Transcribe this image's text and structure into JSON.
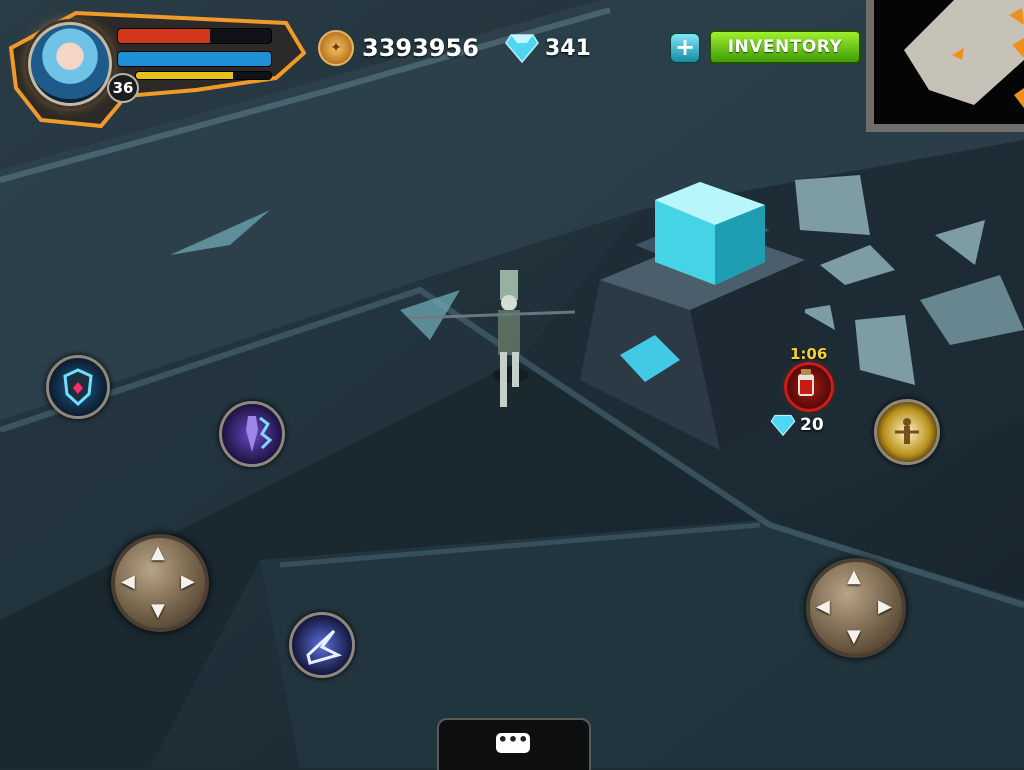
{
  "player": {
    "level": "36",
    "health_fraction": 0.6,
    "mana_fraction": 1.0,
    "xp_fraction": 0.72,
    "colors": {
      "health": "#d2361b",
      "mana": "#1f8fd6",
      "xp": "#e7c21a"
    }
  },
  "currency": {
    "gold": "3393956",
    "gems": "341",
    "gold_icon": "gold-coin-icon",
    "gem_icon": "diamond-icon"
  },
  "buttons": {
    "inventory_label": "INVENTORY",
    "add_gems_icon": "plus-icon"
  },
  "buff": {
    "timer": "1:06",
    "reward_gems": "20",
    "potion_icon": "health-potion-icon"
  },
  "skills": [
    {
      "name": "shield-skill",
      "icon": "shield-icon"
    },
    {
      "name": "summon-skill",
      "icon": "figure-icon"
    },
    {
      "name": "lightning-skill",
      "icon": "lightning-icon"
    },
    {
      "name": "aura-skill",
      "icon": "aura-icon"
    }
  ],
  "controls": {
    "left_dpad_icon": "move-arrows-icon",
    "right_dpad_icon": "move-arrows-icon",
    "chat_icon": "speech-bubble-icon"
  }
}
